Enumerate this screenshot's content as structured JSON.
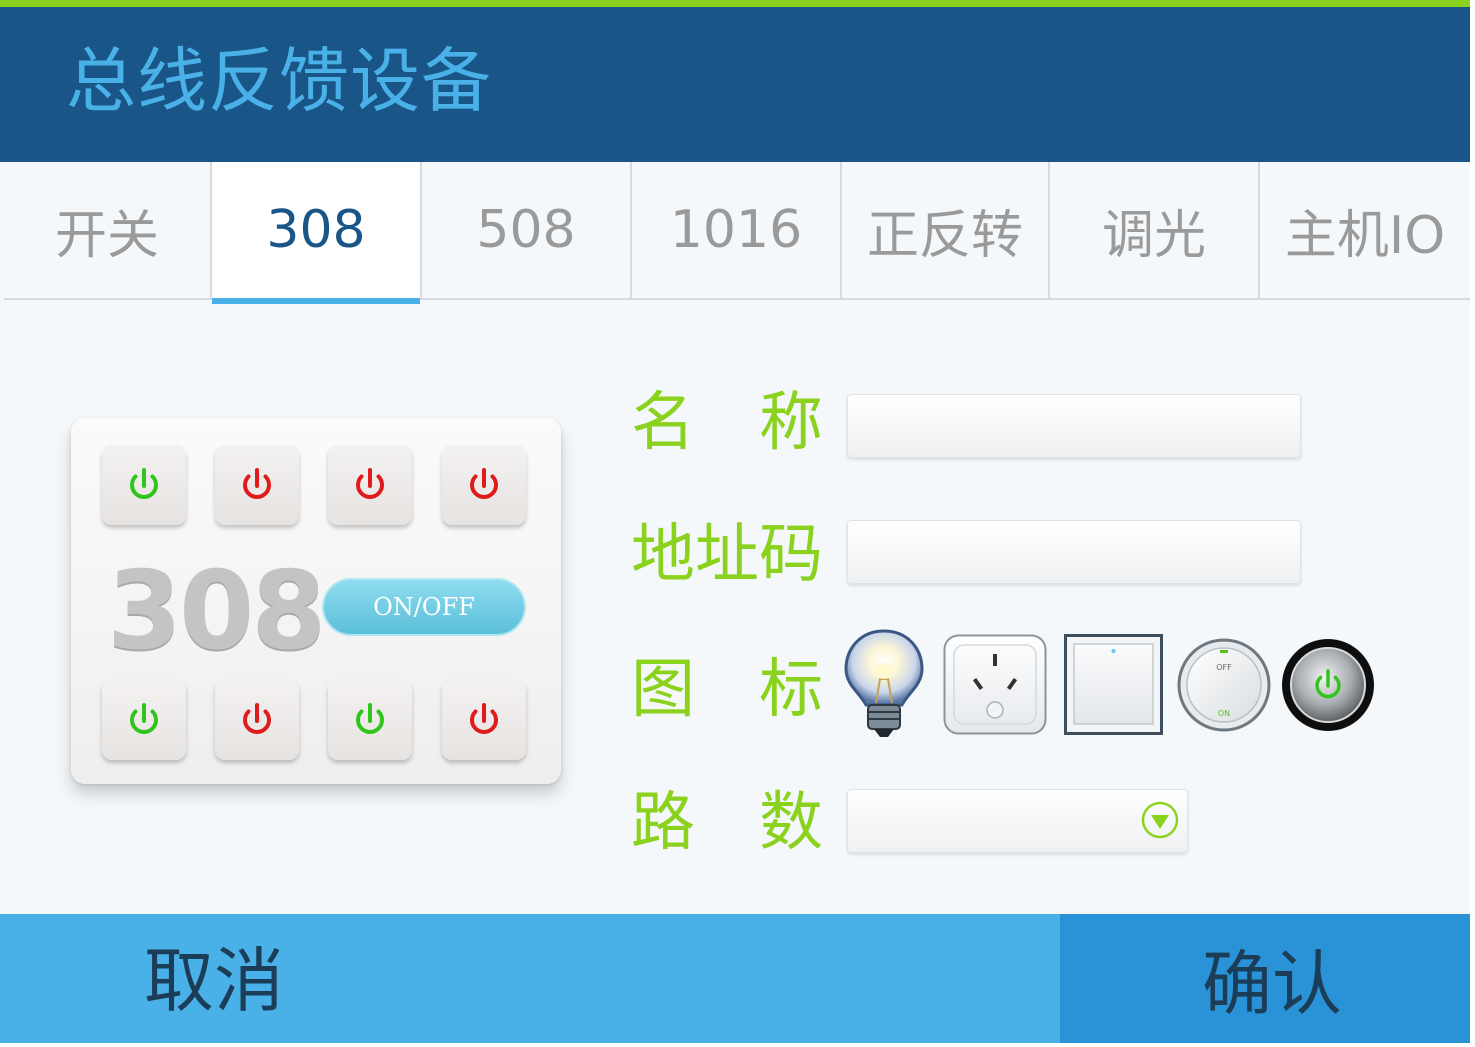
{
  "header": {
    "title": "总线反馈设备"
  },
  "tabs": [
    {
      "label": "开关",
      "active": false
    },
    {
      "label": "308",
      "active": true
    },
    {
      "label": "508",
      "active": false
    },
    {
      "label": "1016",
      "active": false
    },
    {
      "label": "正反转",
      "active": false
    },
    {
      "label": "调光",
      "active": false
    },
    {
      "label": "主机IO",
      "active": false
    }
  ],
  "device_panel": {
    "model": "308",
    "onoff_label": "ON/OFF",
    "buttons_top": [
      "green",
      "red",
      "red",
      "red"
    ],
    "buttons_bottom": [
      "green",
      "red",
      "green",
      "red"
    ]
  },
  "form": {
    "name_label": "名　称",
    "name_value": "",
    "address_label": "地址码",
    "address_value": "",
    "icon_label": "图　标",
    "icons": [
      "light-bulb-icon",
      "power-socket-icon",
      "wall-switch-icon",
      "off-on-knob-icon",
      "power-button-icon"
    ],
    "channels_label": "路　数",
    "channels_value": ""
  },
  "switch_icon_text": {
    "off": "OFF",
    "on": "ON"
  },
  "footer": {
    "cancel": "取消",
    "confirm": "确认"
  },
  "colors": {
    "header_bg": "#1a5587",
    "accent_blue": "#4ab1e8",
    "confirm_bg": "#2a93d8",
    "label_green": "#8bd21f",
    "power_green": "#2fc51c",
    "power_red": "#e01b1b"
  }
}
